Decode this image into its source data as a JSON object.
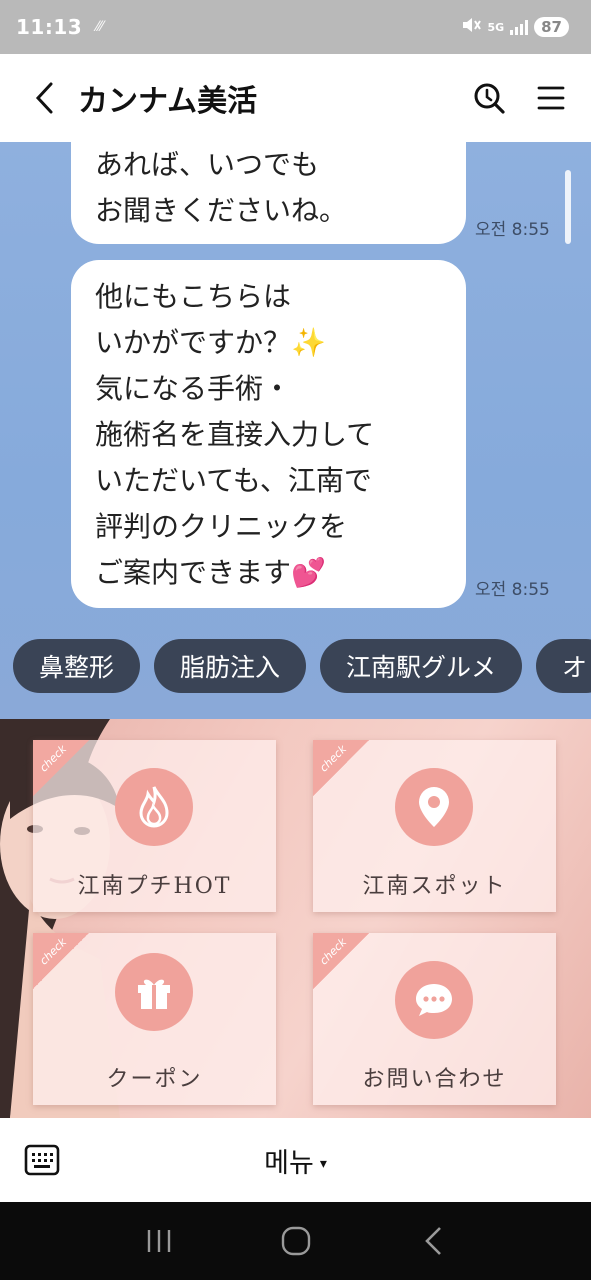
{
  "status": {
    "time": "11:13",
    "battery": "87",
    "network": "5G"
  },
  "header": {
    "title": "カンナム美活"
  },
  "messages": [
    {
      "lines": [
        "あれば、いつでも",
        "お聞きくださいね。"
      ],
      "time": "오전 8:55"
    },
    {
      "lines": [
        "他にもこちらは",
        "いかがですか？✨",
        "気になる手術・",
        "施術名を直接入力して",
        "いただいても、江南で",
        "評判のクリニックを",
        "ご案内できます💕"
      ],
      "time": "오전 8:55"
    }
  ],
  "quick_replies": [
    "鼻整形",
    "脂肪注入",
    "江南駅グルメ",
    "オ"
  ],
  "rich_menu": {
    "badge": "check",
    "tiles": [
      {
        "label": "江南プチHOT",
        "icon": "flame-icon"
      },
      {
        "label": "江南スポット",
        "icon": "map-pin-icon"
      },
      {
        "label": "クーポン",
        "icon": "gift-icon"
      },
      {
        "label": "お問い合わせ",
        "icon": "chat-bubble-icon"
      }
    ]
  },
  "bottom": {
    "menu_label": "메뉴",
    "caret": "▾"
  },
  "colors": {
    "chat_bg": "#8fb0de",
    "chip_bg": "#3a4456",
    "accent": "#f0a29b"
  }
}
